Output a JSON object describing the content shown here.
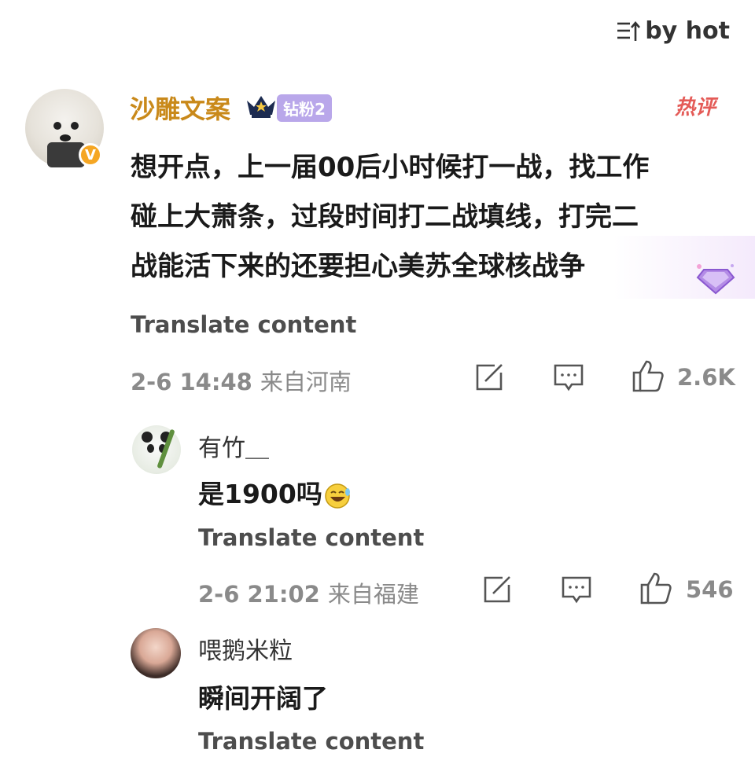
{
  "sort": {
    "label": "by hot"
  },
  "comment": {
    "username": "沙雕文案",
    "fan_badge": "钻粉2",
    "hot_tag": "热评",
    "lines": [
      "想开点，上一届00后小时候打一战，找工作",
      "碰上大萧条，过段时间打二战填线，打完二",
      "战能活下来的还要担心美苏全球核战争"
    ],
    "translate": "Translate content",
    "date": "2-6 14:48",
    "location": "来自河南",
    "likes": "2.6K"
  },
  "replies": [
    {
      "username": "有竹＿",
      "text": "是1900吗",
      "translate": "Translate content",
      "date": "2-6 21:02",
      "location": "来自福建",
      "likes": "546"
    },
    {
      "username": "喂鹅米粒",
      "text": "瞬间开阔了",
      "translate": "Translate content"
    }
  ],
  "colors": {
    "username_gold": "#c9891a",
    "fan_badge_purple": "#b9a7ea",
    "hot_red": "#e45b57",
    "verified_orange": "#f5a623",
    "meta_gray": "#8a8a8a"
  },
  "icons": [
    "sort-icon",
    "verified-v-icon",
    "crown-icon",
    "gem-icon",
    "share-edit-icon",
    "comment-icon",
    "like-thumb-icon",
    "laugh-emoji-icon"
  ]
}
